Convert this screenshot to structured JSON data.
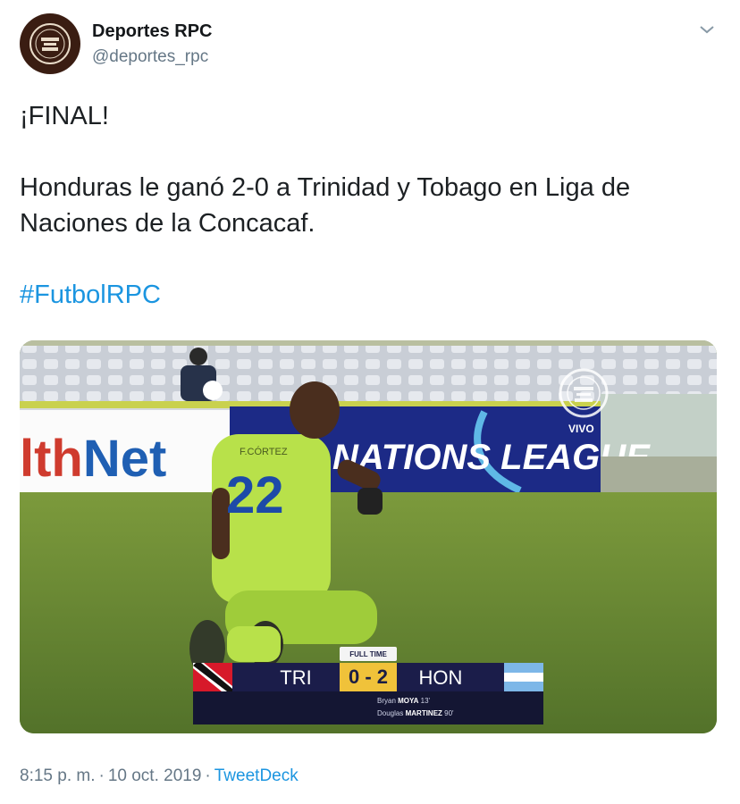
{
  "author": {
    "name": "Deportes RPC",
    "handle": "@deportes_rpc",
    "avatar_icon": "rpc-logo-icon"
  },
  "tweet": {
    "line1": "¡FINAL!",
    "line2": "Honduras le ganó 2-0 a Trinidad y Tobago en Liga de Naciones de la Concacaf.",
    "hashtag": "#FutbolRPC"
  },
  "media": {
    "banner_left": "lthNet",
    "banner_right": "NATIONS LEAGUE",
    "jersey_name": "F.CÓRTEZ",
    "jersey_number": "22",
    "watermark": "VIVO",
    "scoreboard": {
      "status": "FULL TIME",
      "home_team": "TRI",
      "away_team": "HON",
      "score": "0 - 2",
      "scorers": [
        {
          "player": "Bryan",
          "surname": "MOYA",
          "minute": "13'"
        },
        {
          "player": "Douglas",
          "surname": "MARTINEZ",
          "minute": "90'"
        }
      ]
    }
  },
  "footer": {
    "time": "8:15 p. m.",
    "separator": "·",
    "date": "10 oct. 2019",
    "source": "TweetDeck"
  },
  "colors": {
    "link": "#1b95e0",
    "muted": "#657786",
    "text": "#14171a",
    "score_gold": "#f0c23a",
    "board_navy": "#1b1d4a"
  }
}
